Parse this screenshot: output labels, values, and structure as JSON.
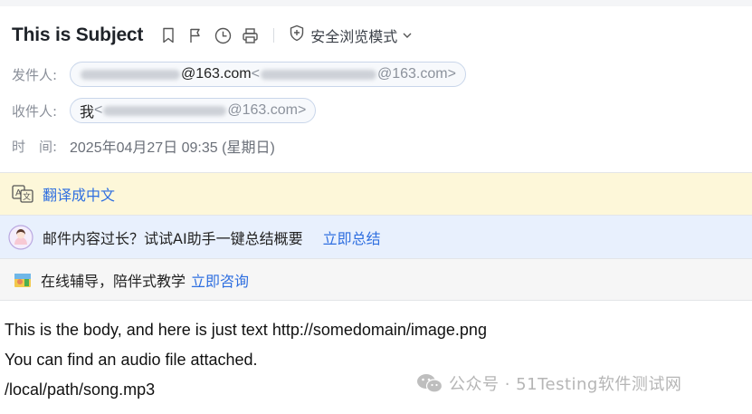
{
  "header": {
    "subject": "This is Subject",
    "safe_mode_label": "安全浏览模式"
  },
  "meta": {
    "sender_label": "发件人:",
    "sender_display_suffix": "@163.com",
    "sender_angle_suffix": "@163.com>",
    "recipient_label": "收件人:",
    "recipient_name": "我",
    "recipient_angle_suffix": "@163.com>",
    "time_label": "时　间:",
    "time_value": "2025年04月27日 09:35 (星期日)"
  },
  "banners": {
    "translate_link": "翻译成中文",
    "ai_text": "邮件内容过长？试试AI助手一键总结概要",
    "ai_link": "立即总结",
    "tutor_text": "在线辅导，陪伴式教学",
    "tutor_link": "立即咨询"
  },
  "body": {
    "lines": [
      "This is the body, and here is just text http://somedomain/image.png",
      "You can find an audio file attached.",
      "/local/path/song.mp3"
    ]
  },
  "watermark": {
    "text": "公众号 · 51Testing软件测试网"
  },
  "colors": {
    "link": "#2f6fe0",
    "translate_bg": "#fdf7d9",
    "ai_bg": "#e8f0fd",
    "tutor_bg": "#f6f6f6"
  }
}
